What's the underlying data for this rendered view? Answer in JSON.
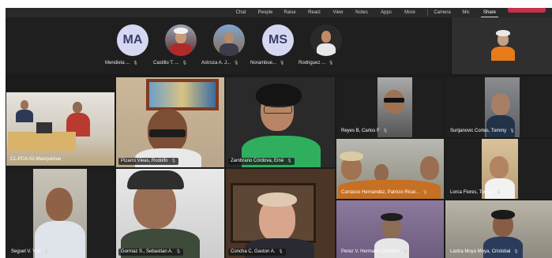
{
  "toolbar": {
    "items": [
      "Chat",
      "People",
      "Raise",
      "React",
      "View",
      "Notes",
      "Apps",
      "More",
      "Camera",
      "Mic",
      "Share"
    ],
    "selected": "Share"
  },
  "strip": [
    {
      "initials": "MA",
      "name": "Mendieta ..."
    },
    {
      "initials": "",
      "name": "Castillo T. ..."
    },
    {
      "initials": "",
      "name": "Astroza A. J..."
    },
    {
      "initials": "MS",
      "name": "Norambue..."
    },
    {
      "initials": "",
      "name": "Rodriguez ..."
    }
  ],
  "tiles": [
    {
      "name": "CL-PCA-02-Manquehue"
    },
    {
      "name": "Pizarro Vieas, Rodolfo"
    },
    {
      "name": "Zambrano Córdova, Emé"
    },
    {
      "name": "Reyes B, Carlos F"
    },
    {
      "name": "Surijanovic Cortes, Tommy"
    },
    {
      "name": "Carrasco Hernandez, Patricio Ricar..."
    },
    {
      "name": "Lorca Flores, Tomas"
    },
    {
      "name": "Seguel V. Yuri"
    },
    {
      "name": "Gormaz S., Sebastian A."
    },
    {
      "name": "Concha C, Gaston A."
    },
    {
      "name": "Perez V. Hermann Christian"
    },
    {
      "name": "Lastra Moya Moya, Cristobal"
    }
  ],
  "colors": {
    "accent": "#c4314b",
    "background": "#1b1b1b",
    "avatar_bg": "#d6d8f2"
  }
}
